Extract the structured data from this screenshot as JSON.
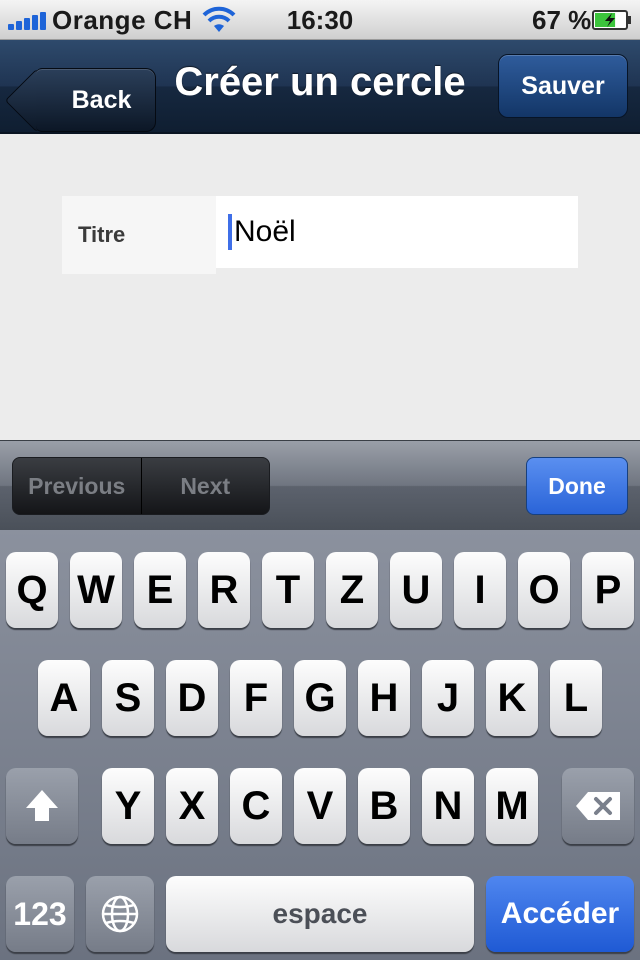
{
  "status_bar": {
    "carrier": "Orange CH",
    "time": "16:30",
    "battery_percent": "67 %",
    "signal_icon": "signal-bars-icon",
    "wifi_icon": "wifi-icon",
    "battery_icon": "battery-charging-icon",
    "battery_level": 0.67
  },
  "nav_bar": {
    "back_label": "Back",
    "title": "Créer un cercle",
    "save_label": "Sauver"
  },
  "form": {
    "field_label": "Titre",
    "field_value": "Noël"
  },
  "toolbar": {
    "previous_label": "Previous",
    "next_label": "Next",
    "done_label": "Done"
  },
  "keyboard": {
    "row1": [
      "Q",
      "W",
      "E",
      "R",
      "T",
      "Z",
      "U",
      "I",
      "O",
      "P"
    ],
    "row2": [
      "A",
      "S",
      "D",
      "F",
      "G",
      "H",
      "J",
      "K",
      "L"
    ],
    "row3": [
      "Y",
      "X",
      "C",
      "V",
      "B",
      "N",
      "M"
    ],
    "shift_icon": "shift-arrow-icon",
    "delete_icon": "backspace-icon",
    "numbers_label": "123",
    "globe_icon": "globe-icon",
    "space_label": "espace",
    "return_label": "Accéder"
  },
  "colors": {
    "accent_blue": "#2a64d8",
    "nav_bar": "#1f3452",
    "caret": "#3f6fe8"
  }
}
